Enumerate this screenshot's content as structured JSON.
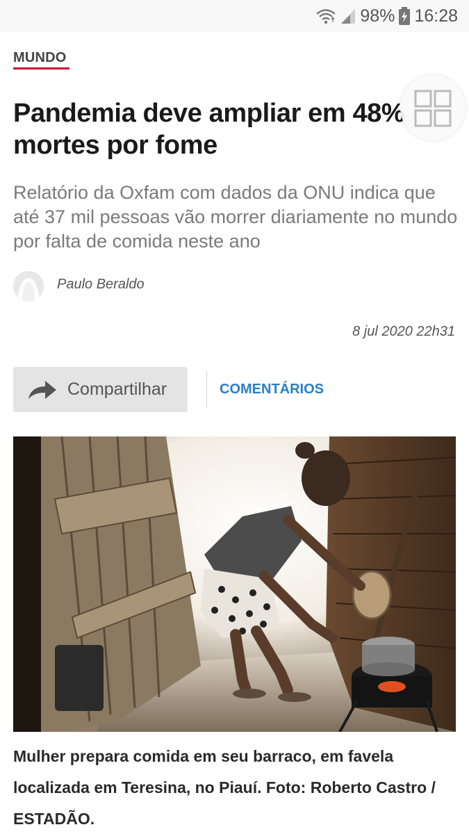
{
  "status_bar": {
    "battery": "98%",
    "time": "16:28",
    "icons": [
      "wifi-icon",
      "signal-icon",
      "battery-charging-icon"
    ]
  },
  "article": {
    "section": "MUNDO",
    "headline": "Pandemia deve ampliar em 48% mortes por fome",
    "subtitle": "Relatório da Oxfam com dados da ONU indica que até 37 mil pessoas vão morrer diariamente no mundo por falta de comida neste ano",
    "author": "Paulo Beraldo",
    "date": "8 jul 2020 22h31"
  },
  "actions": {
    "share_label": "Compartilhar",
    "comments_label": "COMENTÁRIOS"
  },
  "photo": {
    "caption": "Mulher prepara comida em seu barraco, em favela localizada em Teresina, no Piauí. Foto: Roberto Castro / ESTADÃO."
  },
  "colors": {
    "accent_red": "#c8102e",
    "link_blue": "#2a7fc9",
    "share_bg": "#e4e4e4"
  }
}
